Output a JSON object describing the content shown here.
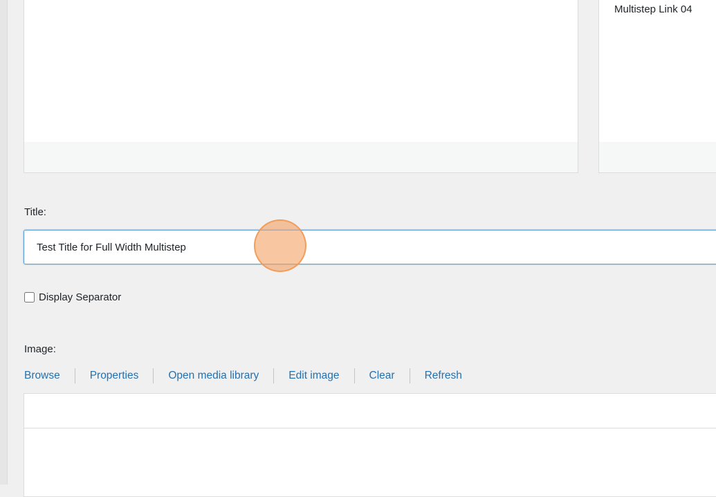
{
  "top_panels": {
    "right_link": "Multistep Link 04"
  },
  "title_field": {
    "label": "Title:",
    "value": "Test Title for Full Width Multistep"
  },
  "separator": {
    "label": "Display Separator",
    "checked": false
  },
  "image_field": {
    "label": "Image:",
    "actions": [
      "Browse",
      "Properties",
      "Open media library",
      "Edit image",
      "Clear",
      "Refresh"
    ]
  },
  "colors": {
    "background": "#f0f0f1",
    "link": "#2271b1",
    "focus_border": "#5b9dd9",
    "click_indicator": "#f5a064"
  }
}
